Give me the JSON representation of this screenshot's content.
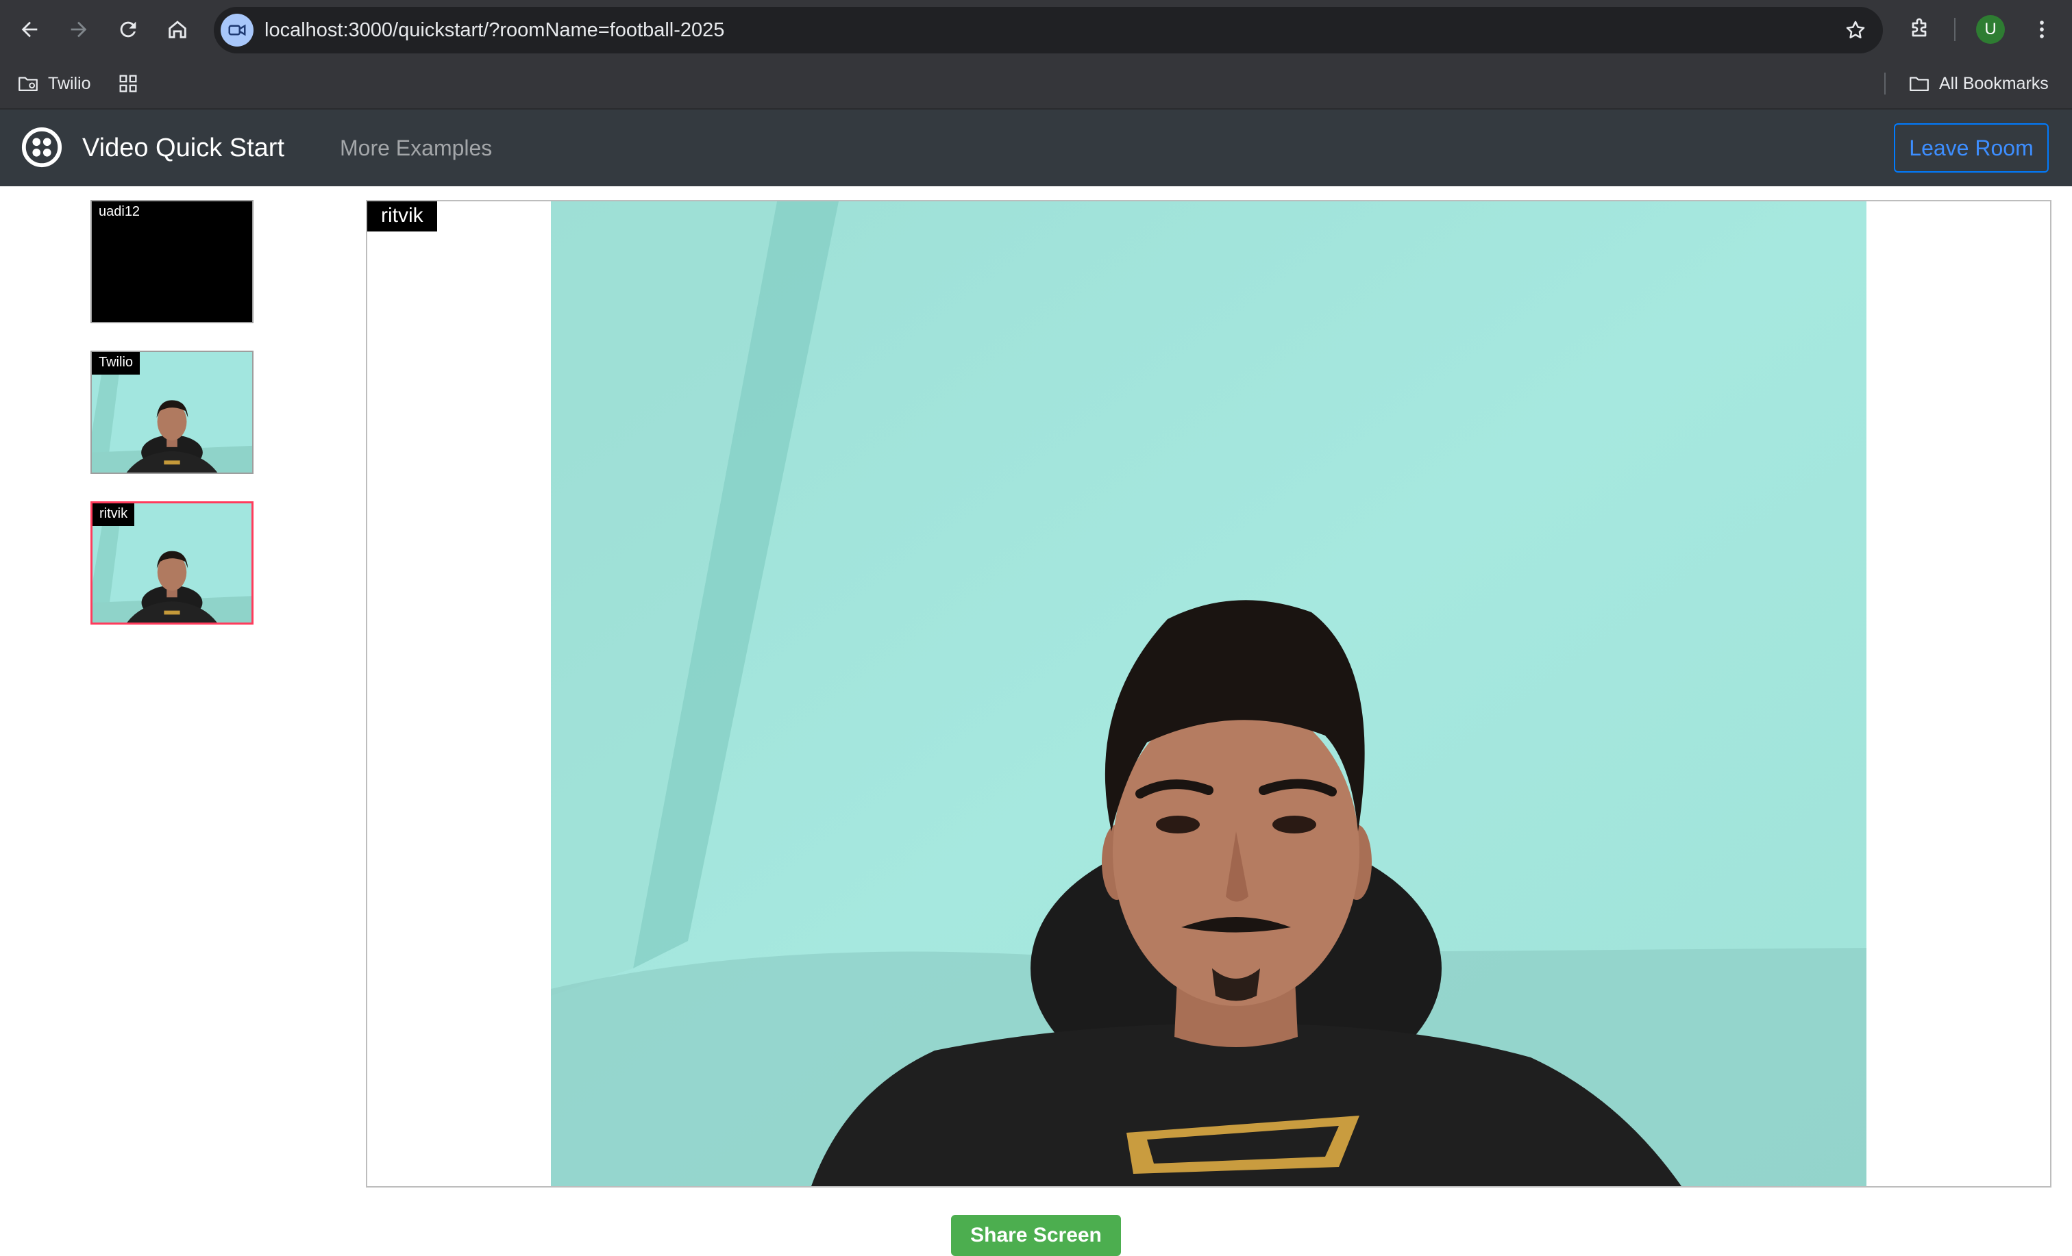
{
  "browser": {
    "url": "localhost:3000/quickstart/?roomName=football-2025",
    "profile_initial": "U",
    "bookmarks": [
      {
        "label": "Twilio"
      }
    ],
    "all_bookmarks_label": "All Bookmarks"
  },
  "navbar": {
    "brand": "Video Quick Start",
    "links": [
      {
        "label": "More Examples"
      }
    ],
    "leave_room_label": "Leave Room"
  },
  "participants": [
    {
      "name": "uadi12",
      "video": "off"
    },
    {
      "name": "Twilio",
      "video": "on"
    },
    {
      "name": "ritvik",
      "video": "on",
      "active": true
    }
  ],
  "main_view": {
    "name": "ritvik"
  },
  "controls": {
    "share_screen_label": "Share Screen"
  },
  "colors": {
    "accent": "#007bff",
    "active_border": "#ff3b5c",
    "share_button": "#4cae4f",
    "video_background": "#a2e6df"
  }
}
